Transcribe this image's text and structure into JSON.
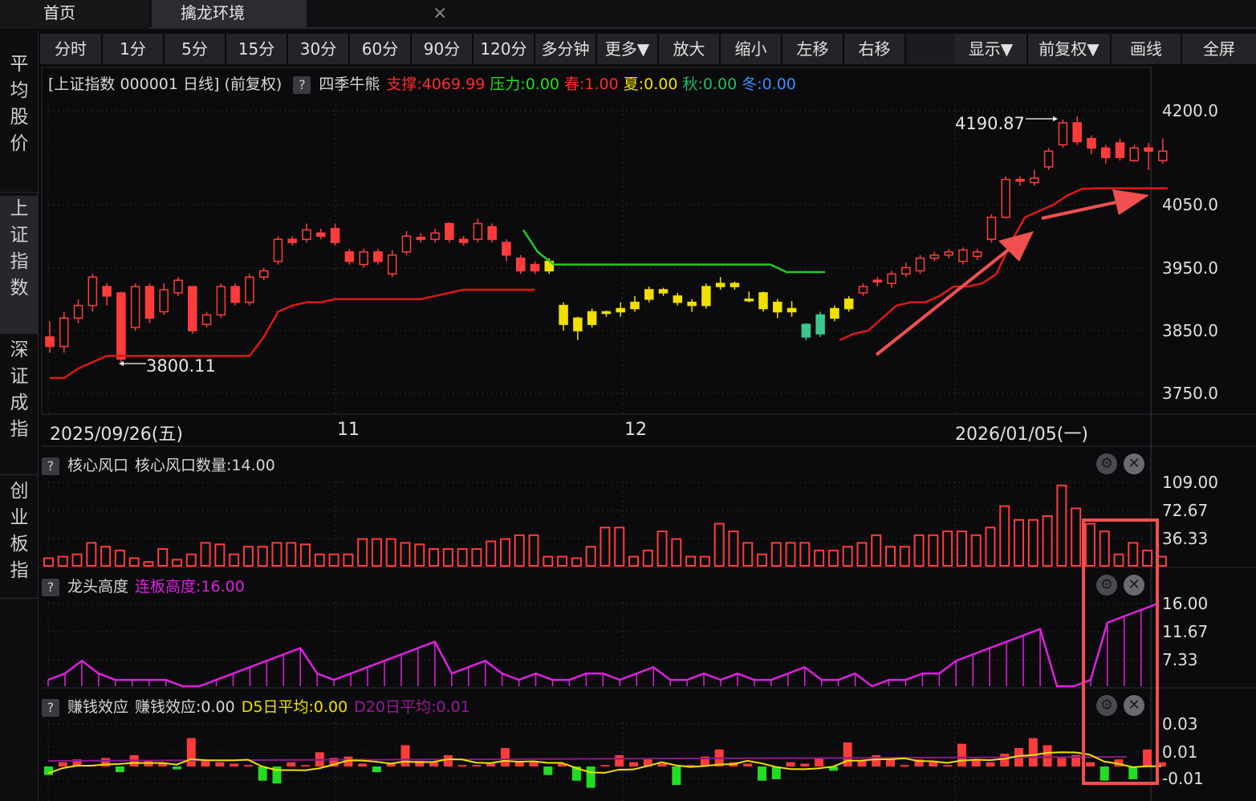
{
  "tabs": {
    "home": "首页",
    "main": "擒龙环境",
    "close": "×"
  },
  "sidebar": [
    {
      "label": "平均股价"
    },
    {
      "label": "上证指数"
    },
    {
      "label": "深证成指"
    },
    {
      "label": "创业板指"
    }
  ],
  "toolbar": {
    "left": [
      "分时",
      "1分",
      "5分",
      "15分",
      "30分",
      "60分",
      "90分",
      "120分",
      "多分钟",
      "更多▼",
      "放大",
      "缩小",
      "左移",
      "右移"
    ],
    "right": [
      "显示▼",
      "前复权▼",
      "画线",
      "全屏"
    ]
  },
  "main_panel": {
    "title": "[上证指数 000001 日线] (前复权)",
    "help": "?",
    "indicator": "四季牛熊",
    "support": "支撑:4069.99",
    "pressure": "压力:0.00",
    "spring": "春:1.00",
    "summer": "夏:0.00",
    "autumn": "秋:0.00",
    "winter": "冬:0.00",
    "high_label": "4190.87",
    "low_label": "3800.11",
    "y_ticks": [
      "4200.0",
      "4050.0",
      "3950.0",
      "3850.0",
      "3750.0"
    ],
    "dates": [
      "2025/09/26(五)",
      "11",
      "12",
      "2026/01/05(一)"
    ]
  },
  "panel1": {
    "help": "?",
    "title": "核心风口",
    "value": "核心风口数量:14.00",
    "y_ticks": [
      "109.00",
      "72.67",
      "36.33"
    ]
  },
  "panel2": {
    "help": "?",
    "title": "龙头高度",
    "value": "连板高度:16.00",
    "y_ticks": [
      "16.00",
      "11.67",
      "7.33"
    ]
  },
  "panel3": {
    "help": "?",
    "title": "赚钱效应",
    "value": "赚钱效应:0.00",
    "d5": "D5日平均:0.00",
    "d20": "D20日平均:0.01",
    "y_ticks": [
      "0.03",
      "0.01",
      "-0.01"
    ]
  },
  "icons": {
    "gear": "⚙",
    "close": "✕"
  },
  "colors": {
    "up": "#ff3c3c",
    "down_green": "#3cc88c",
    "yellow": "#f0e000",
    "green_line": "#22cc22",
    "magenta": "#e020e0",
    "red_line": "#e01818",
    "annotation": "#f05050"
  },
  "chart_data": [
    {
      "type": "candlestick",
      "title": "上证指数 000001 日线",
      "ylim": [
        3720,
        4230
      ],
      "candles": [
        [
          3840,
          3825,
          3865,
          3815,
          "up"
        ],
        [
          3825,
          3870,
          3880,
          3815,
          "up"
        ],
        [
          3870,
          3890,
          3900,
          3862,
          "up"
        ],
        [
          3890,
          3935,
          3940,
          3880,
          "up"
        ],
        [
          3920,
          3905,
          3925,
          3890,
          "down"
        ],
        [
          3910,
          3805,
          3912,
          3800,
          "down"
        ],
        [
          3855,
          3920,
          3925,
          3850,
          "up"
        ],
        [
          3920,
          3870,
          3925,
          3862,
          "down"
        ],
        [
          3880,
          3915,
          3925,
          3875,
          "up"
        ],
        [
          3910,
          3930,
          3935,
          3905,
          "up"
        ],
        [
          3920,
          3850,
          3920,
          3845,
          "down"
        ],
        [
          3860,
          3875,
          3880,
          3855,
          "up"
        ],
        [
          3875,
          3920,
          3925,
          3870,
          "up"
        ],
        [
          3920,
          3895,
          3925,
          3890,
          "down"
        ],
        [
          3895,
          3935,
          3940,
          3890,
          "up"
        ],
        [
          3935,
          3945,
          3950,
          3930,
          "up"
        ],
        [
          3960,
          3995,
          4000,
          3955,
          "up"
        ],
        [
          3990,
          3995,
          4000,
          3985,
          "down"
        ],
        [
          3995,
          4010,
          4020,
          3990,
          "up"
        ],
        [
          4005,
          4000,
          4012,
          3995,
          "down"
        ],
        [
          4012,
          3990,
          4020,
          3985,
          "down"
        ],
        [
          3975,
          3960,
          3980,
          3955,
          "down"
        ],
        [
          3955,
          3975,
          3980,
          3950,
          "up"
        ],
        [
          3975,
          3960,
          3980,
          3955,
          "down"
        ],
        [
          3940,
          3970,
          3978,
          3935,
          "up"
        ],
        [
          3975,
          4000,
          4008,
          3970,
          "up"
        ],
        [
          3995,
          3998,
          4005,
          3990,
          "down"
        ],
        [
          3995,
          4005,
          4012,
          3990,
          "up"
        ],
        [
          4020,
          3995,
          4022,
          3990,
          "down"
        ],
        [
          3990,
          3995,
          4000,
          3985,
          "down"
        ],
        [
          3995,
          4020,
          4028,
          3990,
          "up"
        ],
        [
          4015,
          3995,
          4020,
          3990,
          "down"
        ],
        [
          3990,
          3970,
          3995,
          3960,
          "down"
        ],
        [
          3965,
          3945,
          3970,
          3940,
          "down"
        ],
        [
          3955,
          3945,
          3960,
          3940,
          "down"
        ],
        [
          3945,
          3960,
          3965,
          3940,
          "y"
        ],
        [
          3890,
          3860,
          3895,
          3850,
          "y"
        ],
        [
          3850,
          3870,
          3872,
          3835,
          "y"
        ],
        [
          3860,
          3880,
          3885,
          3855,
          "y"
        ],
        [
          3880,
          3878,
          3882,
          3872,
          "y"
        ],
        [
          3880,
          3885,
          3895,
          3872,
          "y"
        ],
        [
          3885,
          3895,
          3905,
          3880,
          "y"
        ],
        [
          3900,
          3915,
          3920,
          3895,
          "y"
        ],
        [
          3915,
          3910,
          3918,
          3905,
          "y"
        ],
        [
          3905,
          3895,
          3910,
          3890,
          "y"
        ],
        [
          3895,
          3890,
          3900,
          3880,
          "y"
        ],
        [
          3890,
          3920,
          3925,
          3885,
          "y"
        ],
        [
          3920,
          3925,
          3935,
          3915,
          "y"
        ],
        [
          3925,
          3920,
          3928,
          3915,
          "y"
        ],
        [
          3900,
          3900,
          3912,
          3895,
          "y"
        ],
        [
          3910,
          3885,
          3912,
          3880,
          "y"
        ],
        [
          3895,
          3880,
          3900,
          3870,
          "y"
        ],
        [
          3885,
          3880,
          3897,
          3872,
          "y"
        ],
        [
          3860,
          3840,
          3862,
          3835,
          "g"
        ],
        [
          3845,
          3875,
          3880,
          3840,
          "g"
        ],
        [
          3870,
          3885,
          3890,
          3865,
          "y"
        ],
        [
          3885,
          3900,
          3905,
          3880,
          "y"
        ],
        [
          3910,
          3920,
          3925,
          3905,
          "up"
        ],
        [
          3930,
          3928,
          3935,
          3920,
          "up"
        ],
        [
          3925,
          3940,
          3945,
          3918,
          "up"
        ],
        [
          3940,
          3950,
          3958,
          3935,
          "up"
        ],
        [
          3945,
          3965,
          3970,
          3940,
          "up"
        ],
        [
          3965,
          3970,
          3975,
          3960,
          "up"
        ],
        [
          3970,
          3975,
          3980,
          3965,
          "up"
        ],
        [
          3960,
          3978,
          3982,
          3955,
          "up"
        ],
        [
          3968,
          3975,
          3980,
          3962,
          "up"
        ],
        [
          3995,
          4030,
          4035,
          3990,
          "up"
        ],
        [
          4030,
          4090,
          4095,
          4028,
          "up"
        ],
        [
          4090,
          4088,
          4095,
          4080,
          "up"
        ],
        [
          4085,
          4092,
          4105,
          4080,
          "up"
        ],
        [
          4110,
          4135,
          4140,
          4105,
          "up"
        ],
        [
          4145,
          4180,
          4185,
          4140,
          "up"
        ],
        [
          4180,
          4150,
          4190,
          4145,
          "down"
        ],
        [
          4155,
          4140,
          4160,
          4130,
          "down"
        ],
        [
          4140,
          4125,
          4145,
          4115,
          "down"
        ],
        [
          4148,
          4125,
          4155,
          4120,
          "down"
        ],
        [
          4120,
          4140,
          4145,
          4118,
          "up"
        ],
        [
          4140,
          4135,
          4148,
          4105,
          "down"
        ],
        [
          4120,
          4135,
          4155,
          4115,
          "up"
        ]
      ],
      "support_line_red": "step line beneath candles",
      "pressure_line_green": "line during yellow phase"
    },
    {
      "type": "bar",
      "title": "核心风口",
      "ylim": [
        0,
        109
      ],
      "values": [
        10,
        12,
        15,
        30,
        25,
        20,
        10,
        5,
        22,
        8,
        15,
        30,
        28,
        15,
        25,
        25,
        30,
        30,
        28,
        15,
        15,
        15,
        35,
        35,
        35,
        30,
        28,
        22,
        22,
        22,
        22,
        32,
        35,
        40,
        40,
        12,
        12,
        10,
        25,
        50,
        50,
        12,
        20,
        45,
        35,
        12,
        12,
        55,
        45,
        30,
        15,
        30,
        30,
        30,
        20,
        20,
        25,
        30,
        40,
        25,
        25,
        40,
        40,
        45,
        45,
        40,
        50,
        78,
        60,
        60,
        65,
        105,
        75,
        55,
        45,
        15,
        30,
        20,
        12
      ]
    },
    {
      "type": "line",
      "title": "龙头高度",
      "ylim": [
        3,
        16
      ],
      "values": [
        4,
        5,
        7,
        5,
        4,
        4,
        4,
        4,
        3,
        3,
        4,
        5,
        6,
        7,
        8,
        9,
        5,
        4,
        5,
        6,
        7,
        8,
        9,
        10,
        5,
        6,
        7,
        5,
        4,
        5,
        4,
        4,
        5,
        5,
        4,
        5,
        6,
        4,
        4,
        5,
        4,
        5,
        4,
        4,
        5,
        6,
        4,
        4,
        5,
        3,
        4,
        4,
        5,
        5,
        7,
        8,
        9,
        10,
        11,
        12,
        3,
        3,
        4,
        13,
        14,
        15,
        16
      ]
    },
    {
      "type": "bar",
      "title": "赚钱效应",
      "ylim": [
        -0.015,
        0.03
      ],
      "values": [
        -0.006,
        0.003,
        0.005,
        0.001,
        0.006,
        -0.004,
        0.008,
        0.004,
        0.002,
        -0.002,
        0.02,
        0.004,
        0.003,
        0.002,
        0.001,
        -0.01,
        -0.012,
        0.003,
        0.001,
        0.01,
        0.006,
        0.007,
        0.002,
        -0.004,
        0.002,
        0.015,
        0.004,
        0.003,
        0.008,
        0.001,
        0.001,
        0.002,
        0.013,
        0.004,
        0.003,
        -0.006,
        0.002,
        -0.01,
        -0.015,
        0.001,
        0.008,
        0.003,
        0.005,
        0.002,
        -0.013,
        0.001,
        0.007,
        0.012,
        0.003,
        0.002,
        -0.01,
        -0.009,
        0.003,
        0.002,
        0.006,
        -0.003,
        0.017,
        0.004,
        0.008,
        0.006,
        0.001,
        0.005,
        0.003,
        0.001,
        0.016,
        0.005,
        0.003,
        0.009,
        0.013,
        0.02,
        0.015,
        0.006,
        0.008,
        0.003,
        -0.01,
        0.005,
        -0.009,
        0.012,
        0.003
      ]
    }
  ]
}
